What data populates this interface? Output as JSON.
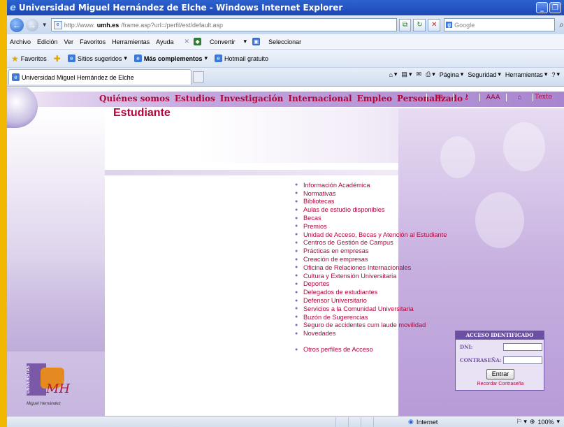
{
  "window": {
    "title": "Universidad Miguel Hernández de Elche - Windows Internet Explorer"
  },
  "address": {
    "url_prefix": "http://www.",
    "url_domain": "umh.es",
    "url_rest": "/frame.asp?url=/perfil/est/default.asp",
    "search_placeholder": "Google"
  },
  "menubar": {
    "items": [
      "Archivo",
      "Edición",
      "Ver",
      "Favoritos",
      "Herramientas",
      "Ayuda"
    ],
    "convertir": "Convertir",
    "seleccionar": "Seleccionar"
  },
  "favbar": {
    "favoritos": "Favoritos",
    "sugeridos": "Sitios sugeridos",
    "complementos": "Más complementos",
    "hotmail": "Hotmail gratuito"
  },
  "tab": {
    "title": "Universidad Miguel Hernández de Elche"
  },
  "cmdbar": {
    "pagina": "Página",
    "seguridad": "Seguridad",
    "herramientas": "Herramientas"
  },
  "site_nav": {
    "items": [
      "Quiénes somos",
      "Estudios",
      "Investigación",
      "Internacional",
      "Empleo",
      "Personalizado"
    ],
    "text_label": "Texto",
    "aaa": "AAA"
  },
  "page": {
    "title": "Estudiante"
  },
  "links": [
    "Información Académica",
    "Normativas",
    "Bibliotecas",
    "Aulas de estudio disponibles",
    "Becas",
    "Premios",
    "Unidad de Acceso, Becas y Atención al Estudiante",
    "Centros de Gestión de Campus",
    "Prácticas en empresas",
    "Creación de empresas",
    "Oficina de Relaciones Internacionales",
    "Cultura y Extensión Universitaria",
    "Deportes",
    "Delegados de estudiantes",
    "Defensor Universitario",
    "Servicios a la Comunidad Universitaria",
    "Buzón de Sugerencias",
    "Seguro de accidentes cum laude movilidad",
    "Novedades"
  ],
  "other_link": "Otros perfiles de Acceso",
  "login": {
    "header": "ACCESO IDENTIFICADO",
    "dni_label": "DNI:",
    "password_label": "CONTRASEÑA:",
    "submit": "Entrar",
    "forgot": "Recordar Contraseña"
  },
  "logo": {
    "vertical": "UNIVERSITAS",
    "mark": "MH",
    "caption": "Miguel Hernández"
  },
  "status": {
    "zone": "Internet",
    "zoom": "100%"
  },
  "colors": {
    "brand": "#b0063a",
    "purple": "#6b4fa3",
    "taskbar": "#f2b800"
  }
}
